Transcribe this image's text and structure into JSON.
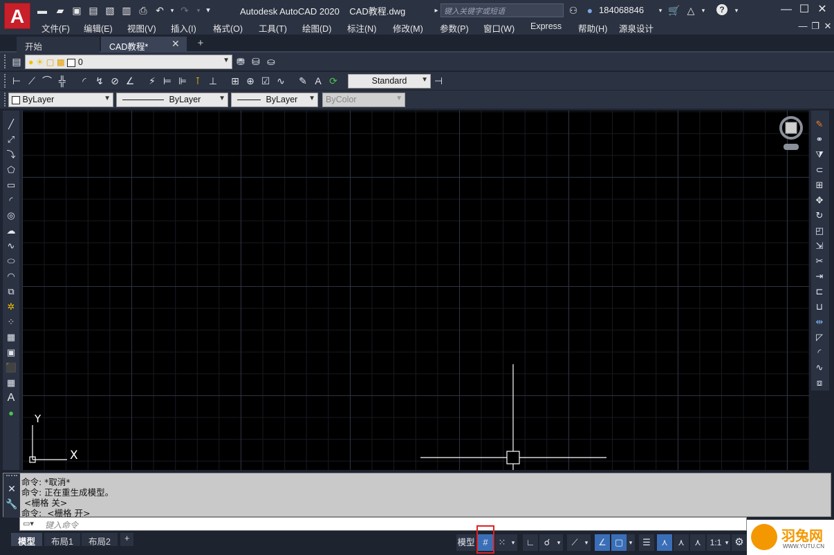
{
  "title": {
    "app": "Autodesk AutoCAD 2020",
    "file": "CAD教程.dwg",
    "logo": "A",
    "search_placeholder": "键入关键字或短语",
    "user": "184068846"
  },
  "menu": [
    "文件(F)",
    "编辑(E)",
    "视图(V)",
    "插入(I)",
    "格式(O)",
    "工具(T)",
    "绘图(D)",
    "标注(N)",
    "修改(M)",
    "参数(P)",
    "窗口(W)",
    "Express",
    "帮助(H)",
    "源泉设计"
  ],
  "tabs": {
    "start": "开始",
    "current": "CAD教程*",
    "close": "✕",
    "add": "+"
  },
  "toolbar": {
    "layer_value": "0",
    "dimstyle_value": "Standard",
    "color_value": "ByLayer",
    "linetype_value": "ByLayer",
    "lineweight_value": "ByLayer",
    "plotstyle_value": "ByColor"
  },
  "canvas": {
    "ucs_x": "X",
    "ucs_y": "Y"
  },
  "command": {
    "history": [
      "命令: *取消*",
      "命令: 正在重生成模型。",
      " <栅格 关>",
      "命令:  <栅格 开>"
    ],
    "placeholder": "键入命令"
  },
  "layout_tabs": [
    "模型",
    "布局1",
    "布局2"
  ],
  "layout_add": "+",
  "status": {
    "model_label": "模型",
    "scale": "1:1"
  },
  "watermark": {
    "brand": "羽兔网",
    "url": "WWW.YUTU.CN"
  }
}
